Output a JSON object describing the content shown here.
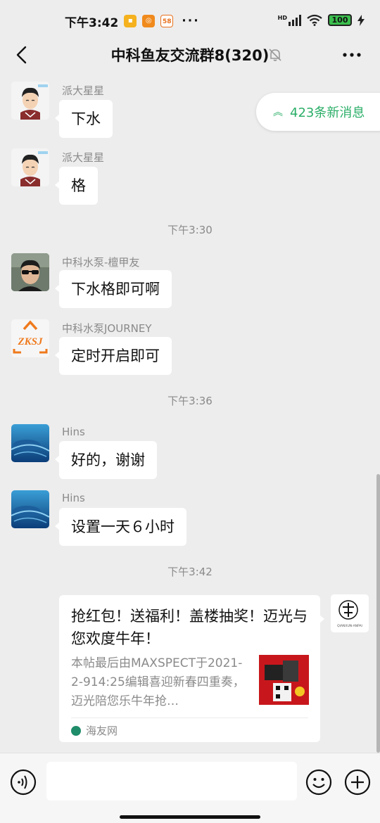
{
  "status_bar": {
    "time": "下午3:42",
    "app_icons": [
      "notes-app-icon",
      "weibo-app-icon",
      "app-58-icon"
    ],
    "app_icon_58": "58",
    "more": "···",
    "hd": "HD",
    "battery": "100"
  },
  "header": {
    "title": "中科鱼友交流群8(320)"
  },
  "new_messages_pill": "423条新消息",
  "messages": [
    {
      "sender": "派大星星",
      "text": "下水"
    },
    {
      "sender": "派大星星",
      "text": "格"
    },
    {
      "time": "下午3:30"
    },
    {
      "sender": "中科水泵-檀甲友",
      "text": "下水格即可啊"
    },
    {
      "sender": "中科水泵JOURNEY",
      "text": "定时开启即可",
      "avatar_text": "ZKSJ"
    },
    {
      "time": "下午3:36"
    },
    {
      "sender": "Hins",
      "text": "好的，谢谢"
    },
    {
      "sender": "Hins",
      "text": "设置一天６小时"
    },
    {
      "time": "下午3:42"
    }
  ],
  "link_card": {
    "title": "抢红包！送福利！盖楼抽奖！迈光与您欢度牛年！",
    "description": "本帖最后由MAXSPECT于2021-2-914:25编辑喜迎新春四重奏，迈光陪您乐牛年抢…",
    "source": "海友网"
  },
  "self_avatar_text": "QIANXUN·ANPAI",
  "input": {
    "placeholder": ""
  },
  "colors": {
    "background": "#ededed",
    "accent_green": "#2aae67",
    "bubble": "#ffffff",
    "meta_gray": "#8a8a8a"
  }
}
